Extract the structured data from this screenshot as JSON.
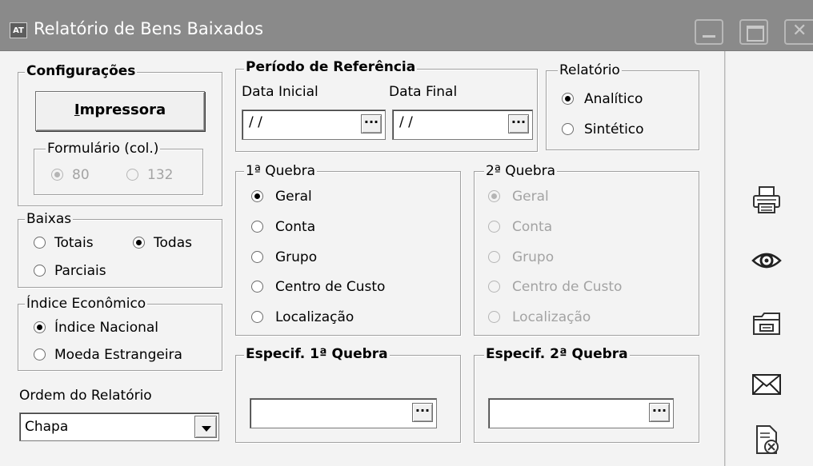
{
  "window": {
    "badge": "AT",
    "title": "Relatório de Bens Baixados"
  },
  "configuracoes": {
    "legend": "Configurações",
    "print_button_accel": "I",
    "print_button_rest": "mpressora",
    "formulario": {
      "legend": "Formulário (col.)",
      "options": [
        {
          "label": "80",
          "checked": true
        },
        {
          "label": "132",
          "checked": false
        }
      ]
    }
  },
  "baixas": {
    "legend": "Baixas",
    "options": [
      {
        "label": "Totais",
        "checked": false
      },
      {
        "label": "Todas",
        "checked": true
      },
      {
        "label": "Parciais",
        "checked": false
      }
    ]
  },
  "indice": {
    "legend": "Índice Econômico",
    "options": [
      {
        "label": "Índice Nacional",
        "checked": true
      },
      {
        "label": "Moeda Estrangeira",
        "checked": false
      }
    ]
  },
  "ordem": {
    "label": "Ordem do Relatório",
    "value": "Chapa"
  },
  "periodo": {
    "legend": "Período de Referência",
    "data_inicial_label": "Data Inicial",
    "data_inicial_value": "/ /",
    "data_final_label": "Data Final",
    "data_final_value": "/ /",
    "dots": "..."
  },
  "relatorio": {
    "legend": "Relatório",
    "options": [
      {
        "label": "Analítico",
        "checked": true
      },
      {
        "label": "Sintético",
        "checked": false
      }
    ]
  },
  "quebra1": {
    "legend": "1ª Quebra",
    "options": [
      {
        "label": "Geral",
        "checked": true
      },
      {
        "label": "Conta",
        "checked": false
      },
      {
        "label": "Grupo",
        "checked": false
      },
      {
        "label": "Centro de Custo",
        "checked": false
      },
      {
        "label": "Localização",
        "checked": false
      }
    ]
  },
  "quebra2": {
    "legend": "2ª Quebra",
    "options": [
      {
        "label": "Geral",
        "checked": true
      },
      {
        "label": "Conta",
        "checked": false
      },
      {
        "label": "Grupo",
        "checked": false
      },
      {
        "label": "Centro de Custo",
        "checked": false
      },
      {
        "label": "Localização",
        "checked": false
      }
    ]
  },
  "especif1": {
    "legend": "Especif. 1ª Quebra",
    "value": "",
    "dots": "..."
  },
  "especif2": {
    "legend": "Especif. 2ª Quebra",
    "value": "",
    "dots": "..."
  },
  "toolbar_icons": [
    "printer-icon",
    "preview-eye-icon",
    "open-folder-icon",
    "mail-envelope-icon",
    "cancel-document-icon"
  ]
}
